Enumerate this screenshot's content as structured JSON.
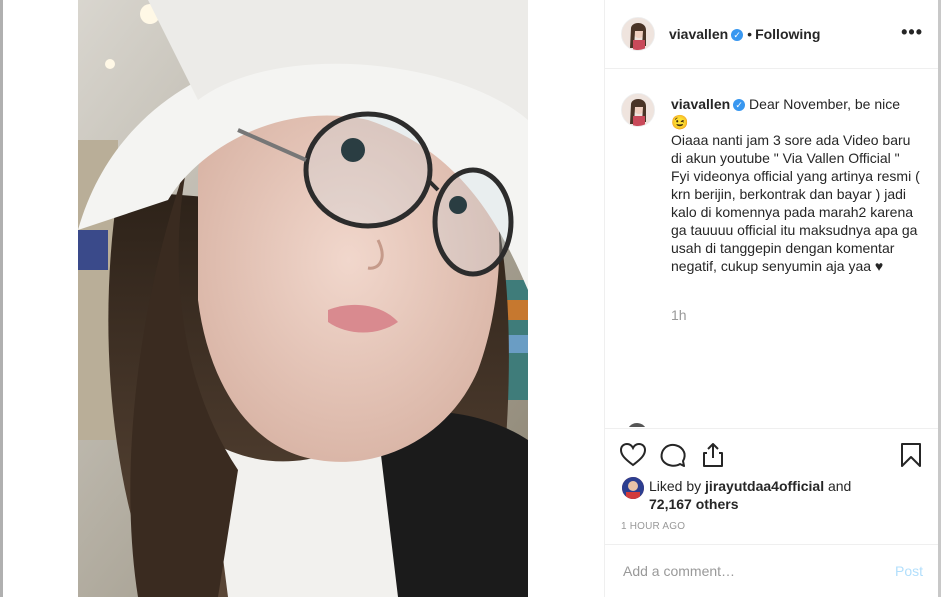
{
  "post": {
    "username": "viavallen",
    "follow_status": "Following",
    "more_label": "•••",
    "caption_first": "Dear November, be nice",
    "caption_body": "😉\nOiaaa nanti jam 3 sore ada Video baru di akun youtube \" Via Vallen Official \" Fyi videonya official yang artinya resmi ( krn berijin, berkontrak dan bayar ) jadi kalo di komennya pada marah2 karena ga tauuuu official itu maksudnya apa ga usah di tanggepin dengan komentar negatif, cukup senyumin aja yaa ♥",
    "caption_age": "1h",
    "liked_prefix": "Liked by ",
    "liked_user": "jirayutdaa4official",
    "liked_and": " and",
    "liked_count": "72,167 others",
    "timestamp": "1 HOUR AGO"
  },
  "comment_form": {
    "placeholder": "Add a comment…",
    "post_label": "Post"
  },
  "icons": {
    "like": "heart-icon",
    "comment": "comment-icon",
    "share": "share-icon",
    "save": "bookmark-icon",
    "verified": "verified-badge-icon"
  },
  "colors": {
    "verified": "#3897f0",
    "post_button": "#b2dffc",
    "muted_text": "#999999"
  }
}
